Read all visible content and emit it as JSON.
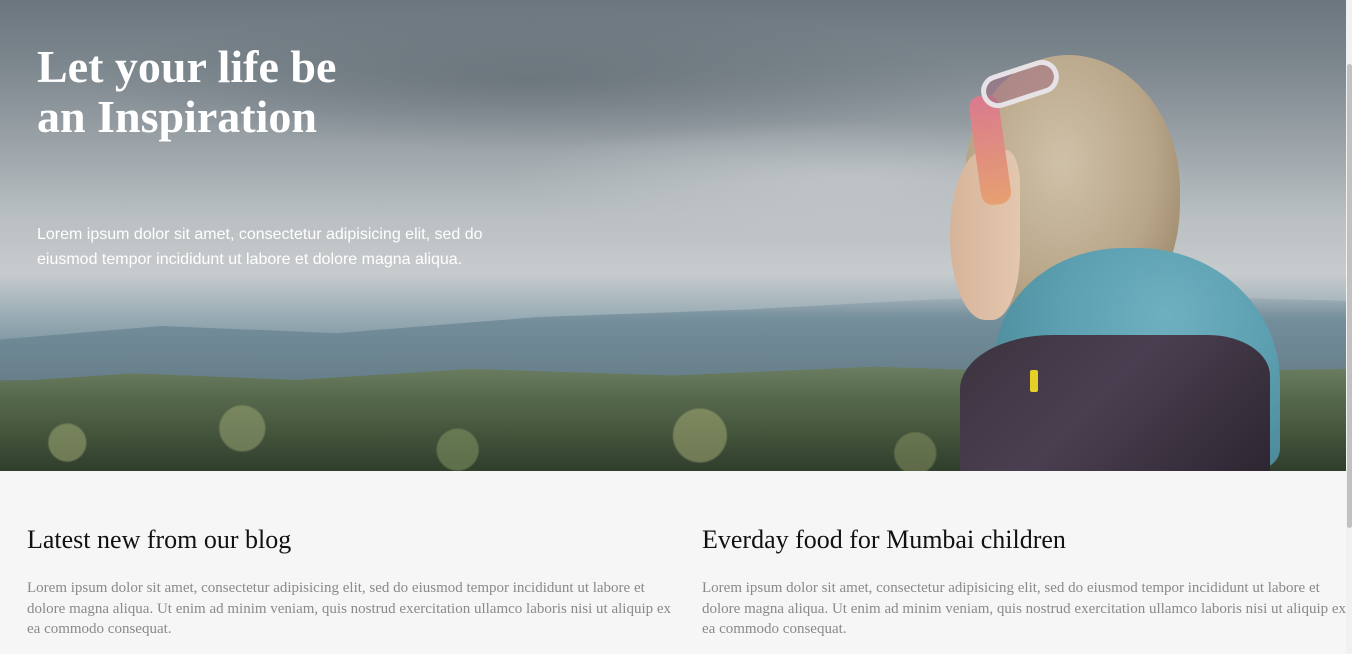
{
  "hero": {
    "title_line1": "Let your life be",
    "title_line2": "an Inspiration",
    "text": "Lorem ipsum dolor sit amet, consectetur adipisicing elit, sed do eiusmod tempor incididunt ut labore et dolore magna aliqua."
  },
  "blog": [
    {
      "title": "Latest new from our blog",
      "text": "Lorem ipsum dolor sit amet, consectetur adipisicing elit, sed do eiusmod tempor incididunt ut labore et dolore magna aliqua. Ut enim ad minim veniam, quis nostrud exercitation ullamco laboris nisi ut aliquip ex ea commodo consequat."
    },
    {
      "title": "Everday food for Mumbai children",
      "text": "Lorem ipsum dolor sit amet, consectetur adipisicing elit, sed do eiusmod tempor incididunt ut labore et dolore magna aliqua. Ut enim ad minim veniam, quis nostrud exercitation ullamco laboris nisi ut aliquip ex ea commodo consequat."
    }
  ],
  "colors": {
    "page_background": "#f6f6f6",
    "heading": "#111111",
    "body_text": "#8a8a8a",
    "hero_text": "#ffffff"
  }
}
